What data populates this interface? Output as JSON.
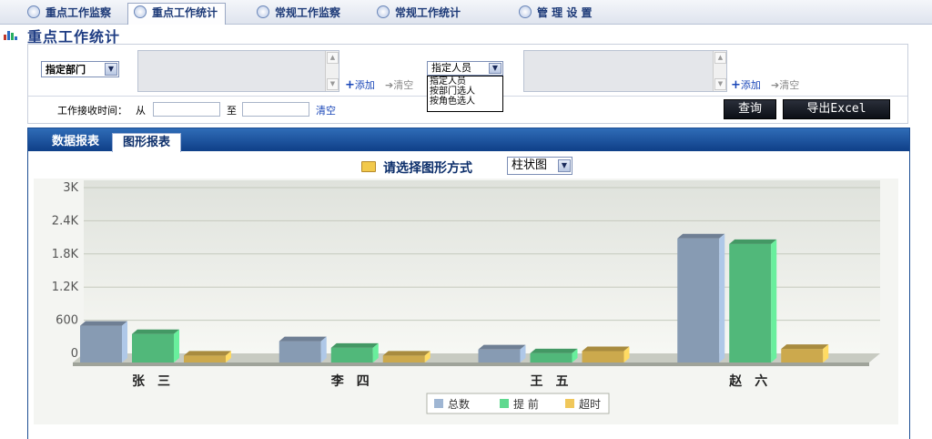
{
  "nav": {
    "tabs": [
      {
        "label": "重点工作监察"
      },
      {
        "label": "重点工作统计"
      },
      {
        "label": "常规工作监察"
      },
      {
        "label": "常规工作统计"
      },
      {
        "label": "管 理 设 置"
      }
    ],
    "active_tab": 1
  },
  "page_title": "重点工作统计",
  "filters": {
    "dept_select": "指定部门",
    "person_select": "指定人员",
    "person_options": [
      "指定人员",
      "按部门选人",
      "按角色选人"
    ],
    "add_label": "添加",
    "clear_label": "清空",
    "time_label": "工作接收时间：",
    "from_label": "从",
    "to_label": "至",
    "time_clear": "清空",
    "query_button": "查询",
    "export_button": "导出Excel"
  },
  "panel": {
    "tabs": [
      {
        "label": "数据报表"
      },
      {
        "label": "图形报表"
      }
    ],
    "active_tab": 1,
    "chooser_label": "请选择图形方式",
    "chart_type_select": "柱状图"
  },
  "colors": {
    "total": "#9fb6d3",
    "early": "#5fd98f",
    "overtime": "#f0c75a",
    "nav_text": "#1d3a78",
    "panel_header": "#1a4f97"
  },
  "chart_data": {
    "type": "bar",
    "categories": [
      "张 三",
      "李 四",
      "王 五",
      "赵 六"
    ],
    "series": [
      {
        "name": "总数",
        "values": [
          600,
          320,
          170,
          2180
        ]
      },
      {
        "name": "提 前",
        "values": [
          450,
          200,
          100,
          2080
        ]
      },
      {
        "name": "超时",
        "values": [
          60,
          60,
          140,
          180
        ]
      }
    ],
    "yticks": [
      "0",
      "600",
      "1.2K",
      "1.8K",
      "2.4K",
      "3K"
    ],
    "ylim": [
      0,
      3000
    ],
    "grid": true,
    "legend_position": "bottom-center"
  }
}
